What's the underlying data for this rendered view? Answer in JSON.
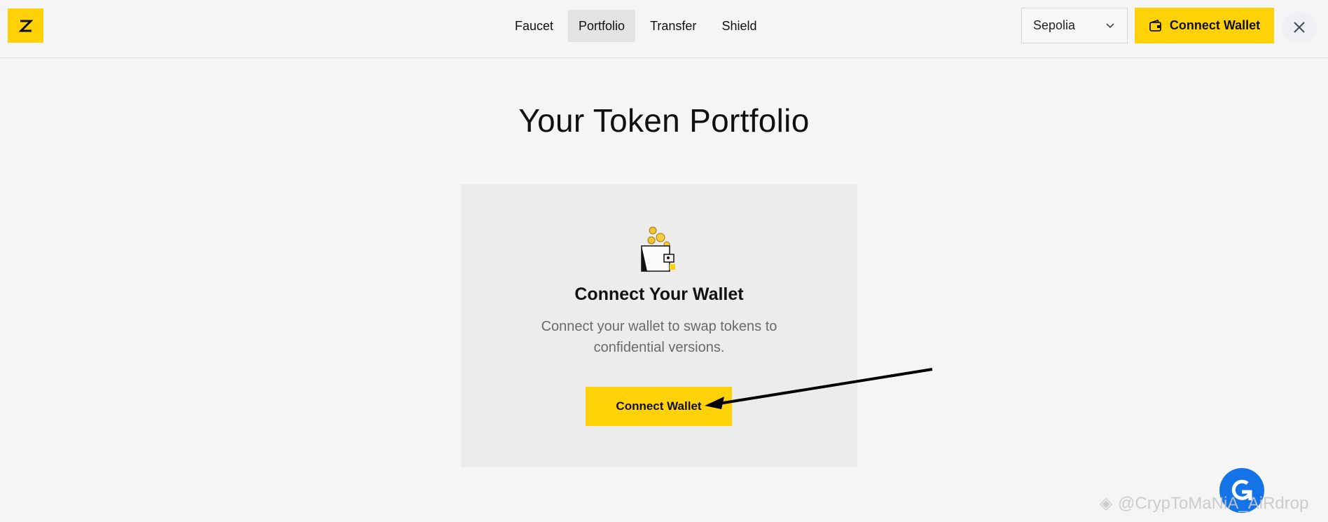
{
  "header": {
    "logo_text": "Z",
    "nav": [
      {
        "label": "Faucet",
        "active": false
      },
      {
        "label": "Portfolio",
        "active": true
      },
      {
        "label": "Transfer",
        "active": false
      },
      {
        "label": "Shield",
        "active": false
      }
    ],
    "network": {
      "selected": "Sepolia"
    },
    "connect_button": "Connect Wallet",
    "close_icon": "close-icon"
  },
  "main": {
    "title": "Your Token Portfolio",
    "card": {
      "illustration": "wallet-coins-icon",
      "title": "Connect Your Wallet",
      "description": "Connect your wallet to swap tokens to confidential versions.",
      "button": "Connect Wallet"
    }
  },
  "overlay": {
    "watermark": "@CrypToMaNiA_AiRdrop",
    "annotation": "arrow pointing to Connect Wallet button"
  },
  "colors": {
    "accent": "#ffd208",
    "background": "#f5f5f5",
    "card": "#ececec",
    "badge": "#1473e6"
  }
}
